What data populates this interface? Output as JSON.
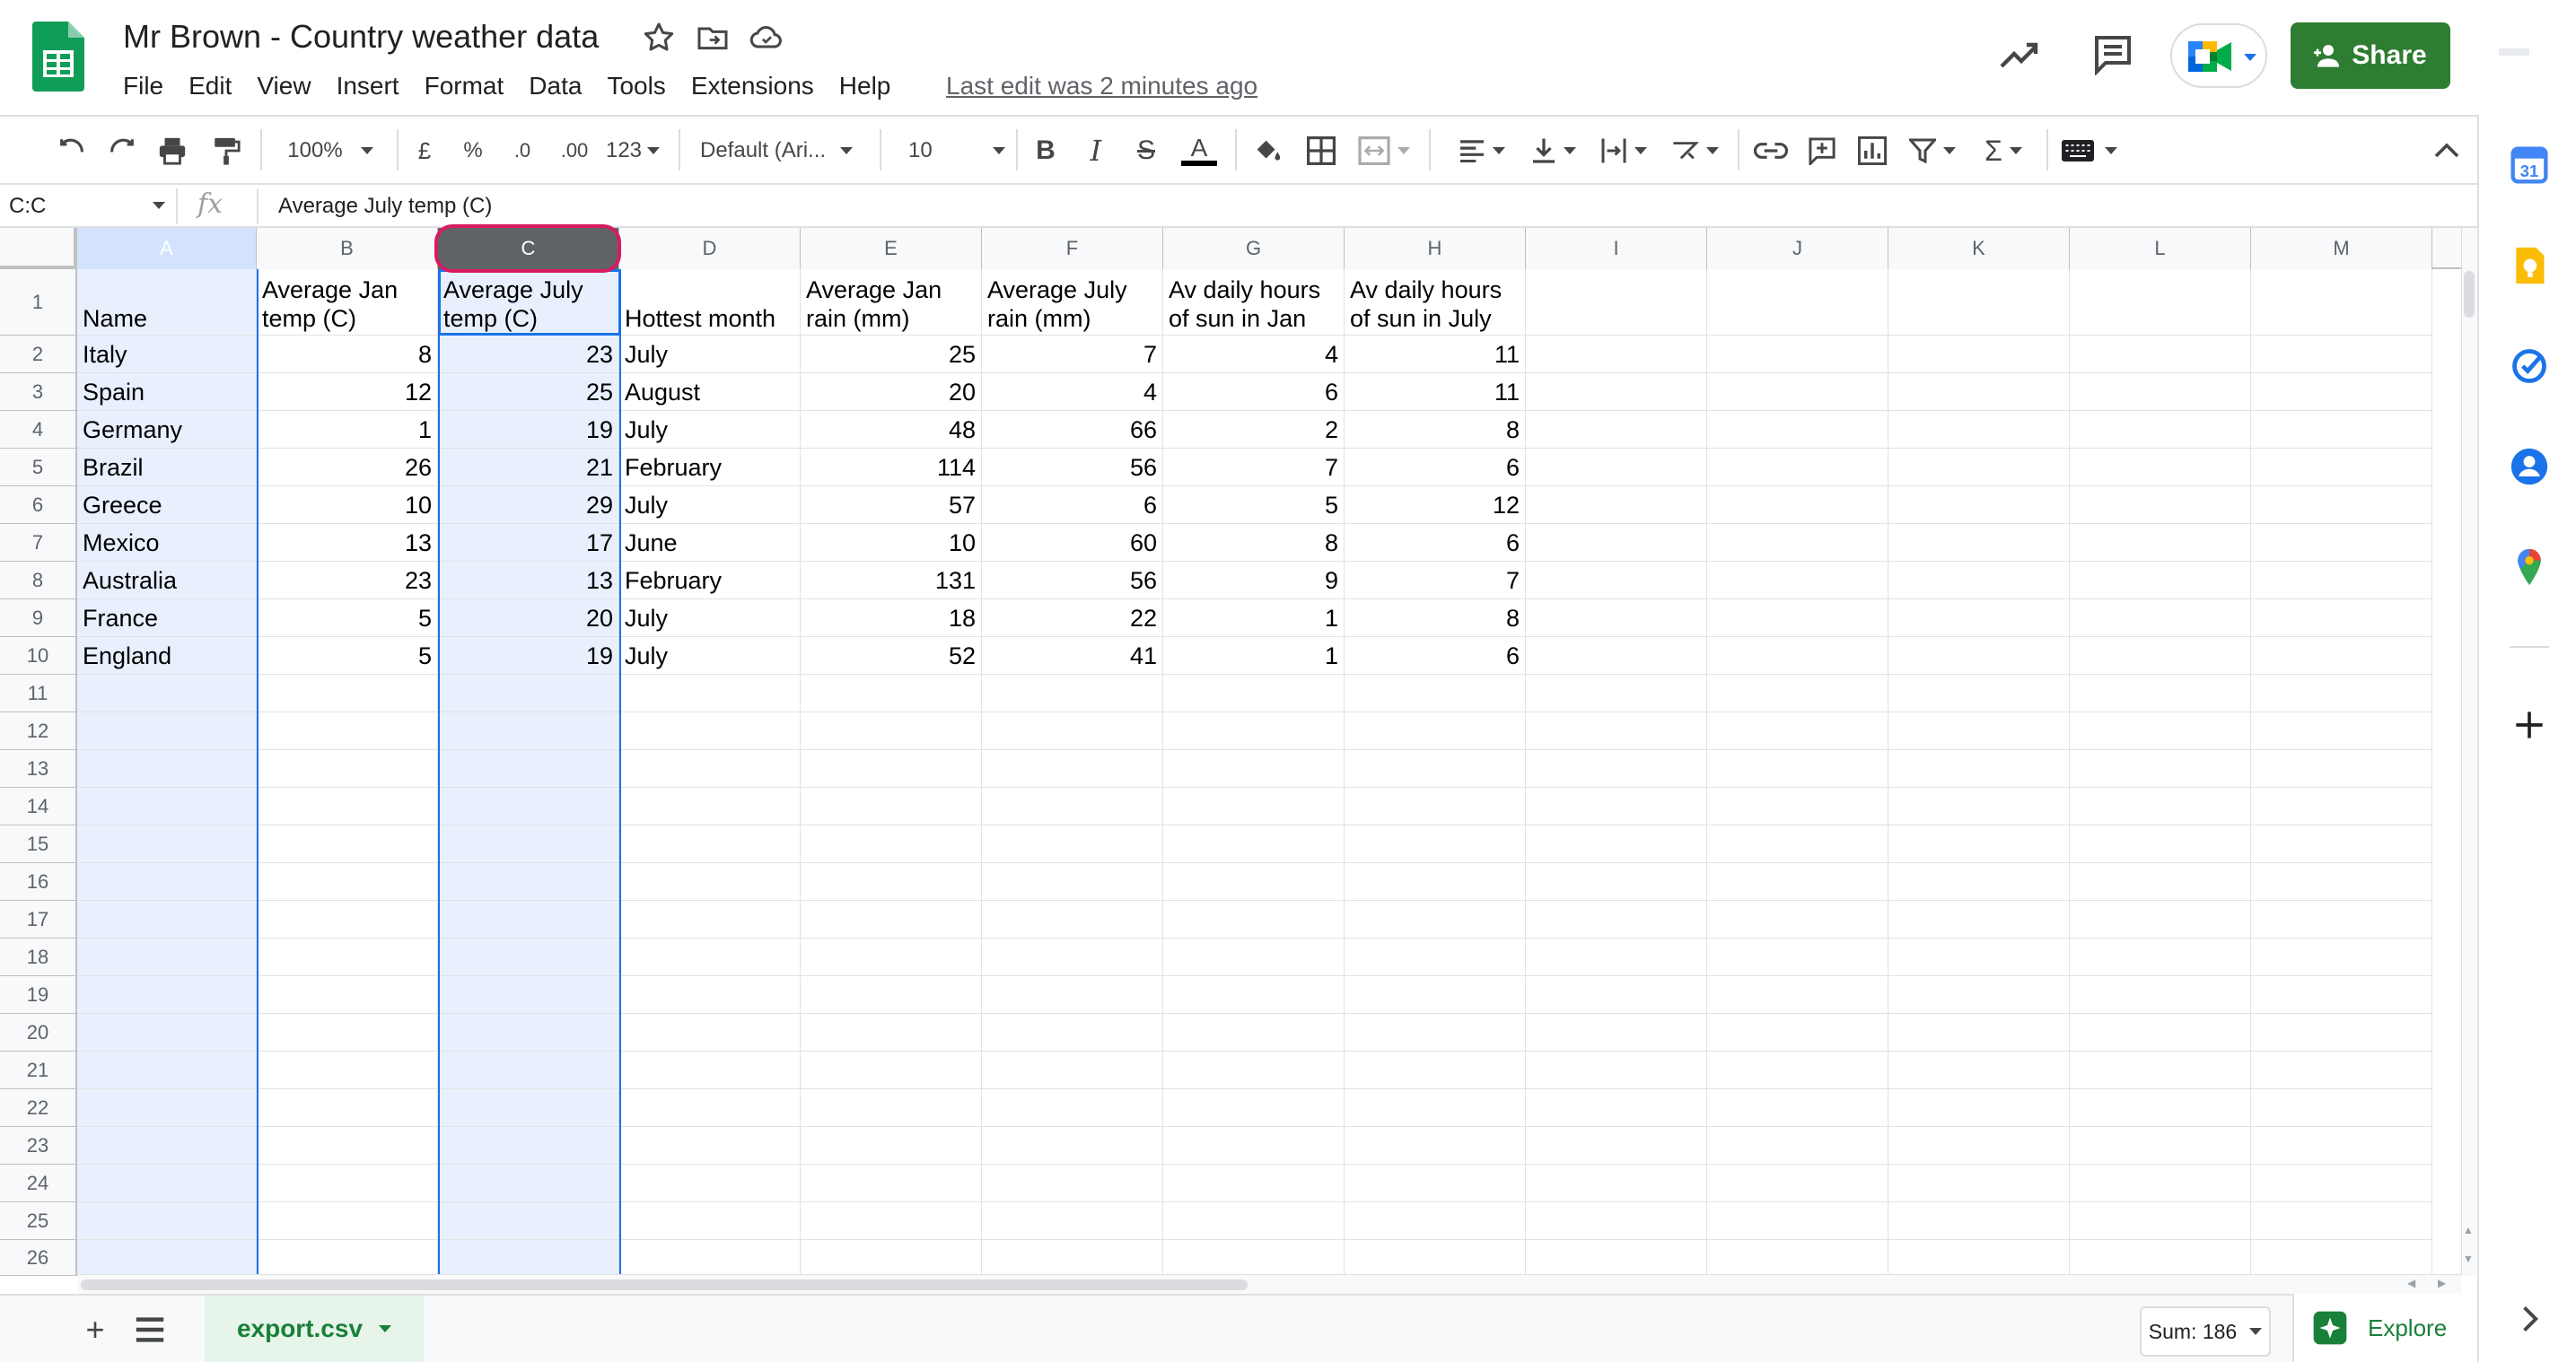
{
  "doc": {
    "title": "Mr Brown - Country weather data",
    "last_edit": "Last edit was 2 minutes ago"
  },
  "menu": [
    "File",
    "Edit",
    "View",
    "Insert",
    "Format",
    "Data",
    "Tools",
    "Extensions",
    "Help"
  ],
  "header": {
    "share_label": "Share"
  },
  "toolbar": {
    "zoom": "100%",
    "currency": "£",
    "percent": "%",
    "dec_decrease": ".0",
    "dec_increase": ".00",
    "more_formats": "123",
    "font": "Default (Ari...",
    "font_size": "10"
  },
  "formula_bar": {
    "name_box": "C:C",
    "fx": "fx",
    "value": "Average July temp (C)"
  },
  "columns": [
    "A",
    "B",
    "C",
    "D",
    "E",
    "F",
    "G",
    "H",
    "I",
    "J",
    "K",
    "L",
    "M"
  ],
  "row_numbers": [
    "1",
    "2",
    "3",
    "4",
    "5",
    "6",
    "7",
    "8",
    "9",
    "10",
    "11",
    "12",
    "13",
    "14",
    "15",
    "16",
    "17",
    "18",
    "19",
    "20",
    "21",
    "22",
    "23",
    "24",
    "25",
    "26"
  ],
  "table": {
    "headers": [
      "Name",
      "Average Jan temp (C)",
      "Average July temp (C)",
      "Hottest month",
      "Average Jan rain (mm)",
      "Average July rain (mm)",
      "Av daily hours of sun in Jan",
      "Av daily hours of sun in July"
    ],
    "rows": [
      [
        "Italy",
        "8",
        "23",
        "July",
        "25",
        "7",
        "4",
        "11"
      ],
      [
        "Spain",
        "12",
        "25",
        "August",
        "20",
        "4",
        "6",
        "11"
      ],
      [
        "Germany",
        "1",
        "19",
        "July",
        "48",
        "66",
        "2",
        "8"
      ],
      [
        "Brazil",
        "26",
        "21",
        "February",
        "114",
        "56",
        "7",
        "6"
      ],
      [
        "Greece",
        "10",
        "29",
        "July",
        "57",
        "6",
        "5",
        "12"
      ],
      [
        "Mexico",
        "13",
        "17",
        "June",
        "10",
        "60",
        "8",
        "6"
      ],
      [
        "Australia",
        "23",
        "13",
        "February",
        "131",
        "56",
        "9",
        "7"
      ],
      [
        "France",
        "5",
        "20",
        "July",
        "18",
        "22",
        "1",
        "8"
      ],
      [
        "England",
        "5",
        "19",
        "July",
        "52",
        "41",
        "1",
        "6"
      ]
    ]
  },
  "bottom": {
    "sheet_tab": "export.csv",
    "sum": "Sum: 186",
    "explore": "Explore"
  },
  "colors": {
    "brand_green": "#2e7d32",
    "selection_blue": "#1a73e8",
    "selection_fill": "#e8f0fe",
    "highlight_circle": "#d81b60"
  },
  "side_icons": [
    "calendar-icon",
    "keep-icon",
    "tasks-icon",
    "contacts-icon",
    "maps-icon",
    "add-icon"
  ]
}
